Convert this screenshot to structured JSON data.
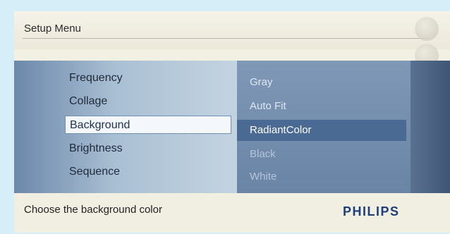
{
  "header": {
    "title": "Setup Menu"
  },
  "left_menu": {
    "items": [
      {
        "label": "Frequency",
        "selected": false
      },
      {
        "label": "Collage",
        "selected": false
      },
      {
        "label": "Background",
        "selected": true
      },
      {
        "label": "Brightness",
        "selected": false
      },
      {
        "label": "Sequence",
        "selected": false
      }
    ]
  },
  "right_menu": {
    "items": [
      {
        "label": "Gray",
        "selected": false
      },
      {
        "label": "Auto Fit",
        "selected": false
      },
      {
        "label": "RadiantColor",
        "selected": true
      },
      {
        "label": "Black",
        "selected": false
      },
      {
        "label": "White",
        "selected": false
      }
    ]
  },
  "footer": {
    "hint": "Choose the background color",
    "brand": "PHILIPS"
  },
  "side_icons": [
    "settings-icon",
    "photo-icon",
    "menu-icon",
    "slideshow-icon"
  ],
  "colors": {
    "selected_highlight": "#4a6a94",
    "brand": "#1f3f7a",
    "page_background": "#d5eef8"
  }
}
